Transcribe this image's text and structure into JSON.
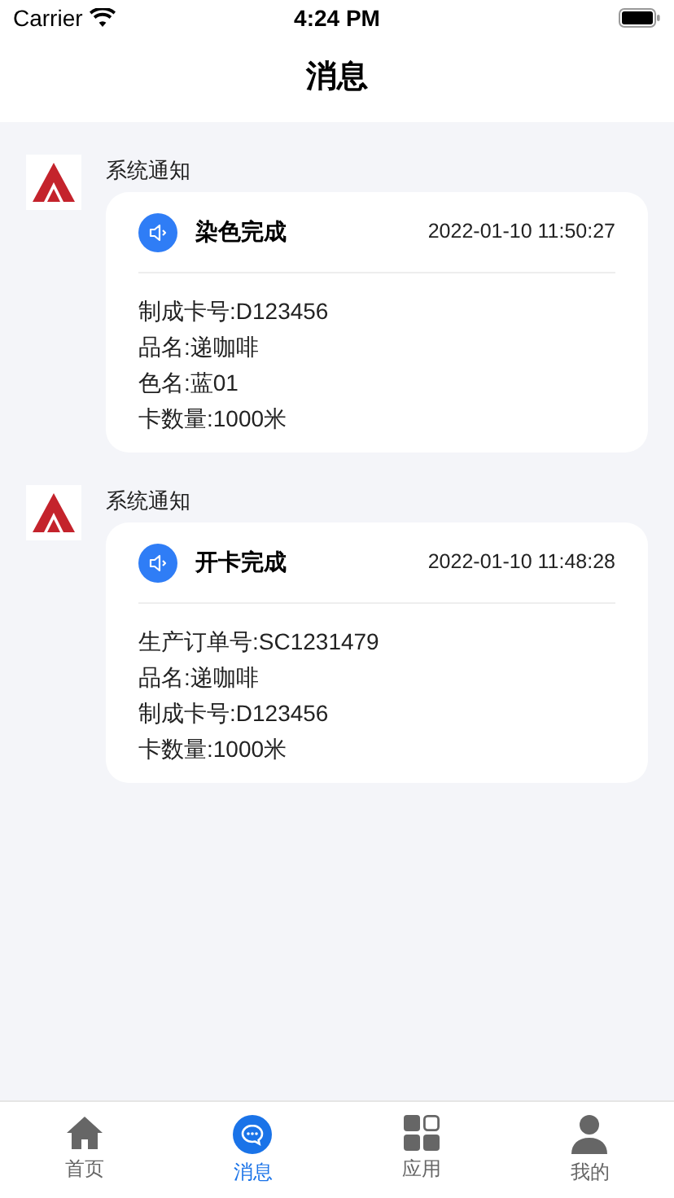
{
  "status_bar": {
    "carrier": "Carrier",
    "time": "4:24 PM"
  },
  "nav": {
    "title": "消息"
  },
  "messages": [
    {
      "sender": "系统通知",
      "title": "染色完成",
      "time": "2022-01-10 11:50:27",
      "lines": [
        "制成卡号:D123456",
        "品名:递咖啡",
        "色名:蓝01",
        "卡数量:1000米"
      ]
    },
    {
      "sender": "系统通知",
      "title": "开卡完成",
      "time": "2022-01-10 11:48:28",
      "lines": [
        "生产订单号:SC1231479",
        "品名:递咖啡",
        "制成卡号:D123456",
        "卡数量:1000米"
      ]
    }
  ],
  "tabs": [
    {
      "kind": "home",
      "label": "首页",
      "selected": false
    },
    {
      "kind": "chat",
      "label": "消息",
      "selected": true
    },
    {
      "kind": "apps",
      "label": "应用",
      "selected": false
    },
    {
      "kind": "user",
      "label": "我的",
      "selected": false
    }
  ]
}
